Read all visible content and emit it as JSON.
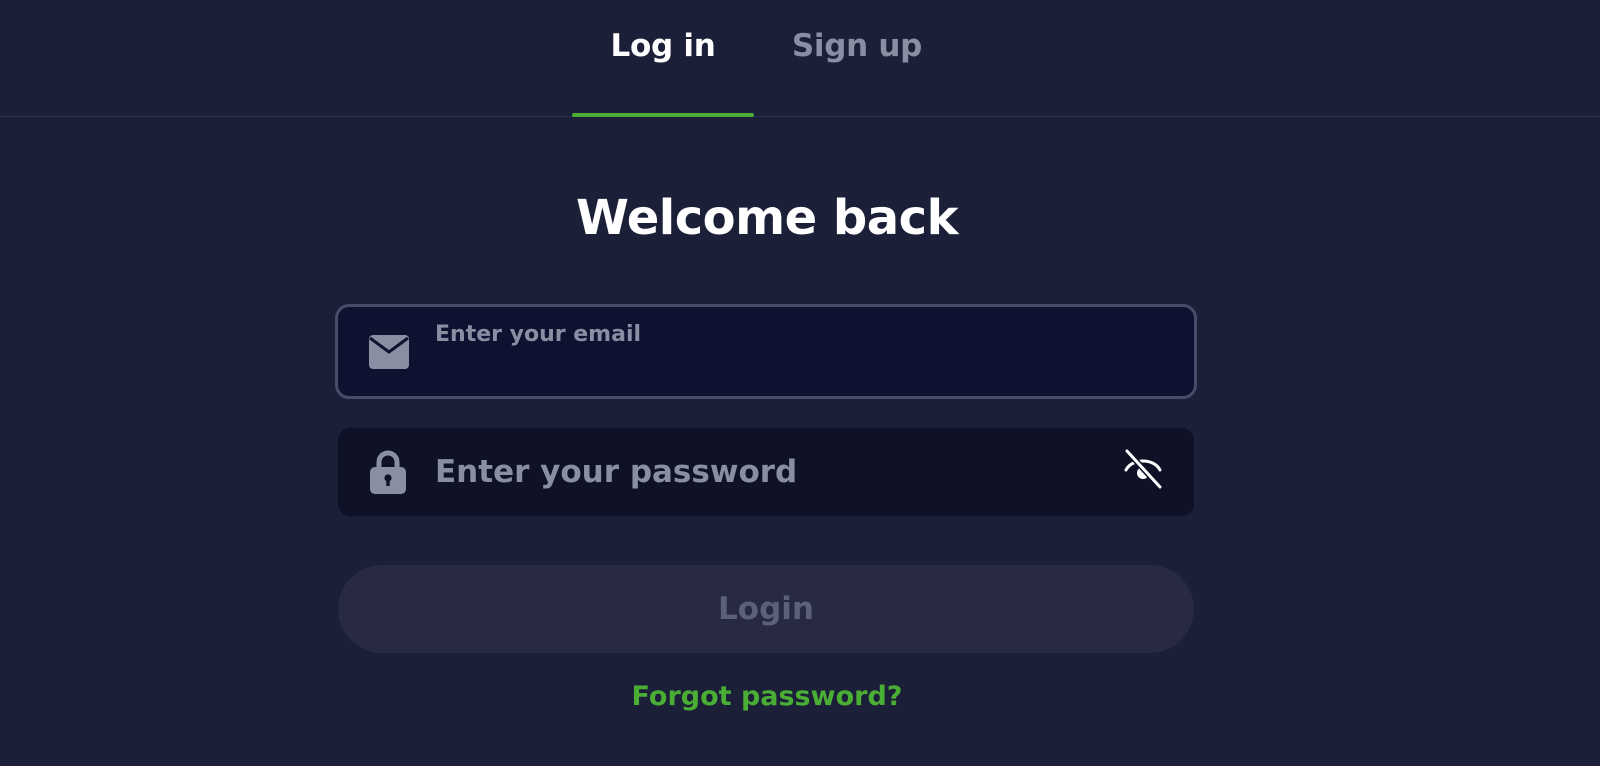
{
  "tabs": {
    "login_label": "Log in",
    "signup_label": "Sign up"
  },
  "title": "Welcome back",
  "email_field": {
    "label": "Enter your email",
    "value": "",
    "icon": "mail-icon"
  },
  "password_field": {
    "placeholder": "Enter your password",
    "value": "",
    "icon": "lock-icon",
    "toggle_icon": "eye-off-icon"
  },
  "login_button": {
    "label": "Login"
  },
  "forgot_link": {
    "label": "Forgot password?"
  },
  "colors": {
    "background": "#1b1f38",
    "accent": "#4aad34",
    "muted_text": "#8a8ea3",
    "disabled_button": "#272a42"
  }
}
